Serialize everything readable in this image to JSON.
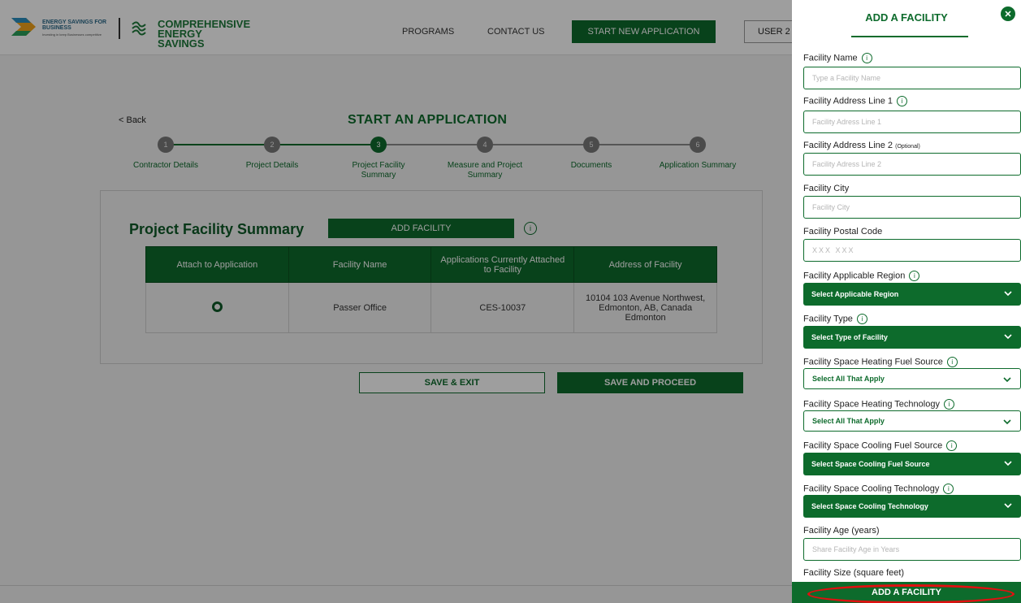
{
  "header": {
    "logo_title": "ENERGY SAVINGS FOR BUSINESS",
    "logo_tagline": "Investing in keep Businesses competitive",
    "brand": "COMPREHENSIVE ENERGY SAVINGS",
    "nav_programs": "PROGRAMS",
    "nav_contact": "CONTACT US",
    "nav_start": "START NEW APPLICATION",
    "user": "USER 2"
  },
  "main": {
    "back": "< Back",
    "title": "START AN APPLICATION",
    "steps": [
      {
        "num": "1",
        "label": "Contractor Details"
      },
      {
        "num": "2",
        "label": "Project Details"
      },
      {
        "num": "3",
        "label": "Project Facility Summary"
      },
      {
        "num": "4",
        "label": "Measure and Project Summary"
      },
      {
        "num": "5",
        "label": "Documents"
      },
      {
        "num": "6",
        "label": "Application Summary"
      }
    ],
    "current_step": 3,
    "panel_title": "Project Facility Summary",
    "add_facility": "ADD FACILITY",
    "info": "i",
    "table": {
      "headers": [
        "Attach to Application",
        "Facility Name",
        "Applications Currently Attached to Facility",
        "Address of Facility"
      ],
      "rows": [
        {
          "name": "Passer Office",
          "apps": "CES-10037",
          "address": "10104 103 Avenue Northwest, Edmonton, AB, Canada Edmonton"
        }
      ]
    },
    "save_exit": "SAVE & EXIT",
    "save_proceed": "SAVE AND PROCEED"
  },
  "drawer": {
    "title": "ADD A FACILITY",
    "close": "✕",
    "info": "i",
    "fields": {
      "name_label": "Facility Name",
      "name_ph": "Type a Facility Name",
      "addr1_label": "Facility Address Line 1",
      "addr1_ph": "Facility Adress Line 1",
      "addr2_label": "Facility Address Line 2",
      "addr2_opt": "(Optional)",
      "addr2_ph": "Facility Adress Line 2",
      "city_label": "Facility City",
      "city_ph": "Facility City",
      "postal_label": "Facility Postal Code",
      "postal_ph": "XXX XXX",
      "region_label": "Facility Applicable Region",
      "region_val": "Select Applicable Region",
      "type_label": "Facility Type",
      "type_val": "Select Type of Facility",
      "heat_fuel_label": "Facility Space Heating Fuel Source",
      "heat_fuel_val": "Select All That Apply",
      "heat_tech_label": "Facility Space Heating Technology",
      "heat_tech_val": "Select All That Apply",
      "cool_fuel_label": "Facility Space Cooling Fuel Source",
      "cool_fuel_val": "Select Space Cooling Fuel Source",
      "cool_tech_label": "Facility Space Cooling Technology",
      "cool_tech_val": "Select Space Cooling Technology",
      "age_label": "Facility Age (years)",
      "age_ph": "Share Facility Age in Years",
      "size_label": "Facility Size (square feet)"
    },
    "submit": "ADD A FACILITY"
  },
  "colors": {
    "brand_green": "#0d6b2c",
    "highlight_red": "#e01010"
  }
}
